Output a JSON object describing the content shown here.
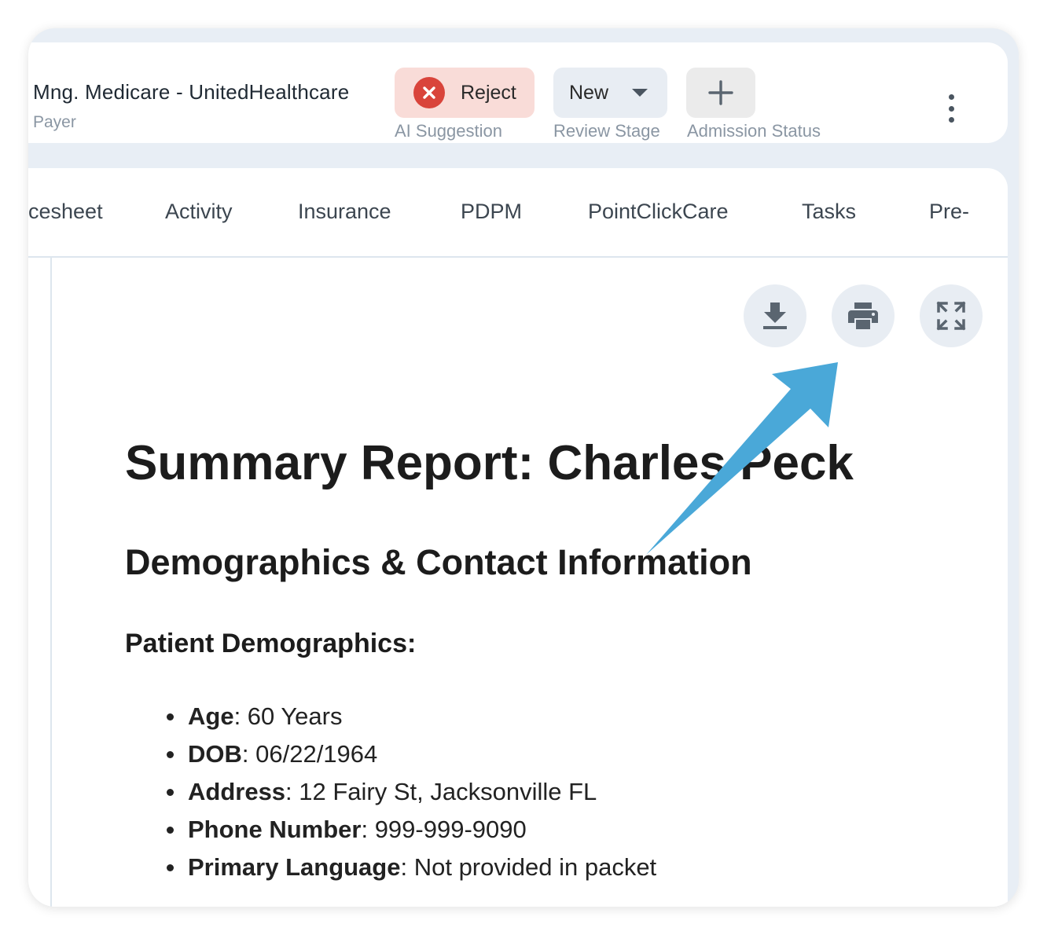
{
  "header": {
    "payer_name": "Mng. Medicare - UnitedHealthcare",
    "payer_label": "Payer",
    "ai_suggestion": {
      "value": "Reject",
      "label": "AI Suggestion"
    },
    "review_stage": {
      "value": "New",
      "label": "Review Stage"
    },
    "admission_status": {
      "label": "Admission Status"
    }
  },
  "tabs": [
    "cesheet",
    "Activity",
    "Insurance",
    "PDPM",
    "PointClickCare",
    "Tasks",
    "Pre-"
  ],
  "report": {
    "title": "Summary Report: Charles Peck",
    "section_title": "Demographics & Contact Information",
    "subsection_title": "Patient Demographics:",
    "items": [
      {
        "label": "Age",
        "value": ": 60 Years"
      },
      {
        "label": "DOB",
        "value": ": 06/22/1964"
      },
      {
        "label": "Address",
        "value": ": 12 Fairy St, Jacksonville FL"
      },
      {
        "label": "Phone Number",
        "value": ": 999-999-9090"
      },
      {
        "label": "Primary Language",
        "value": ": Not provided in packet"
      }
    ]
  },
  "colors": {
    "accent_arrow": "#4aa8d8",
    "reject_bg": "#f9dcd8",
    "reject_icon": "#d9443b",
    "frame_bg": "#e8eef5"
  },
  "icons": [
    "reject-x-icon",
    "dropdown-caret-icon",
    "plus-icon",
    "kebab-menu-icon",
    "download-icon",
    "print-icon",
    "fullscreen-icon"
  ]
}
